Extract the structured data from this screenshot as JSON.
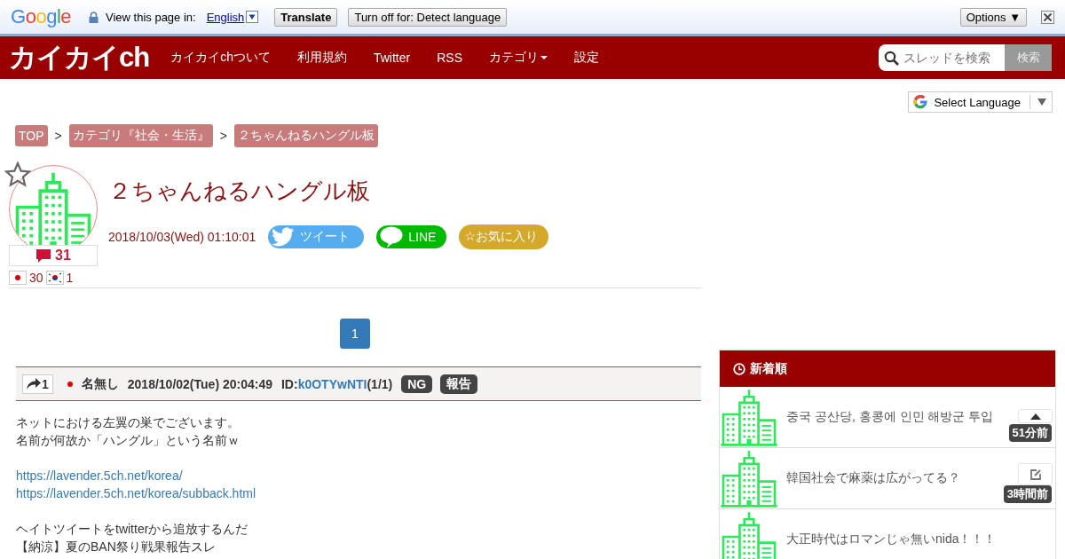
{
  "translate_bar": {
    "logo": "Google",
    "label": "View this page in:",
    "language": "English",
    "translate_button": "Translate",
    "turn_off_button": "Turn off for: Detect language",
    "options_button": "Options ▼"
  },
  "nav": {
    "logo": "カイカイch",
    "items": [
      {
        "label": "カイカイchついて",
        "kind": "link"
      },
      {
        "label": "利用規約",
        "kind": "link"
      },
      {
        "label": "Twitter",
        "kind": "link"
      },
      {
        "label": "RSS",
        "kind": "link"
      },
      {
        "label": "カテゴリ",
        "kind": "dropdown"
      },
      {
        "label": "設定",
        "kind": "link"
      }
    ],
    "search": {
      "placeholder": "スレッドを検索",
      "button": "検索"
    }
  },
  "language_select": "Select Language",
  "breadcrumb_separator": ">",
  "breadcrumbs": [
    "TOP",
    "カテゴリ『社会・生活』",
    "２ちゃんねるハングル板"
  ],
  "thread": {
    "title": "２ちゃんねるハングル板",
    "date": "2018/10/03(Wed) 01:10:01",
    "comment_count": "31",
    "flags": [
      {
        "kind": "jp",
        "count": "30"
      },
      {
        "kind": "kr",
        "count": "1"
      }
    ],
    "share": {
      "tweet": "ツイート",
      "line": "LINE",
      "favorite": "☆お気に入り"
    }
  },
  "pagination": [
    {
      "label": "1",
      "selected": true
    }
  ],
  "post": {
    "number": "1",
    "name": "名無し",
    "date": "2018/10/02(Tue) 20:04:49",
    "id_label": "ID:",
    "id": "k0OTYwNTI",
    "id_count": "(1/1)",
    "buttons": [
      "NG",
      "報告"
    ],
    "blocks": [
      {
        "kind": "text",
        "lines": [
          "ネットにおける左翼の巣でございます。",
          "名前が何故か「ハングル」という名前ｗ"
        ]
      },
      {
        "kind": "link",
        "lines": [
          "https://lavender.5ch.net/korea/",
          "https://lavender.5ch.net/korea/subback.html"
        ]
      },
      {
        "kind": "text",
        "lines": [
          "ヘイトツイートをtwitterから追放するんだ",
          "【納涼】夏のBAN祭り戦果報告スレ"
        ]
      }
    ]
  },
  "sidebar": {
    "title": "新着順",
    "items": [
      {
        "title": "중국 공산당, 홍콩에 인민 해방군 투입",
        "time": "51分前"
      },
      {
        "title": "韓国社会で麻薬は広がってる？",
        "time": "3時間前"
      },
      {
        "title": "大正時代はロマンじゃ無いnida！！！"
      }
    ]
  }
}
